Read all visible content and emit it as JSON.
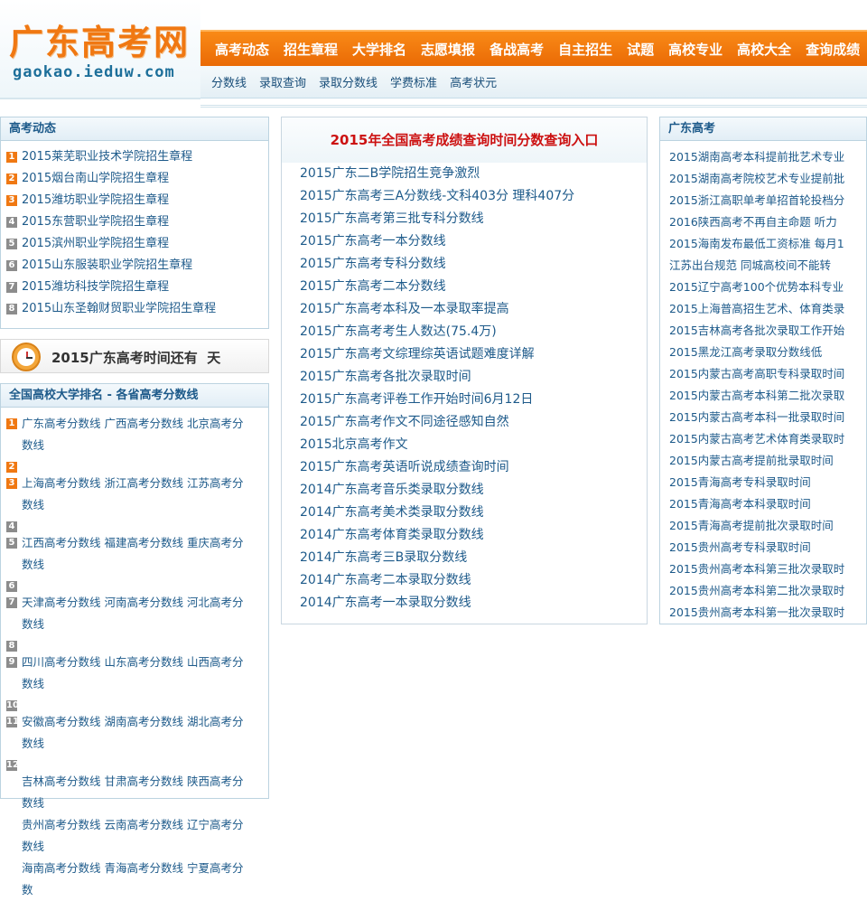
{
  "logo": {
    "main": "广东高考网",
    "sub": "gaokao.ieduw.com"
  },
  "nav_main": [
    "高考动态",
    "招生章程",
    "大学排名",
    "志愿填报",
    "备战高考",
    "自主招生",
    "试题",
    "高校专业",
    "高校大全",
    "查询成绩"
  ],
  "nav_sub": [
    "分数线",
    "录取查询",
    "录取分数线",
    "学费标准",
    "高考状元"
  ],
  "left_news": {
    "title": "高考动态",
    "items": [
      {
        "num": "1",
        "text": "2015莱芜职业技术学院招生章程"
      },
      {
        "num": "2",
        "text": "2015烟台南山学院招生章程"
      },
      {
        "num": "3",
        "text": "2015潍坊职业学院招生章程"
      },
      {
        "num": "4",
        "text": "2015东营职业学院招生章程"
      },
      {
        "num": "5",
        "text": "2015滨州职业学院招生章程"
      },
      {
        "num": "6",
        "text": "2015山东服装职业学院招生章程"
      },
      {
        "num": "7",
        "text": "2015潍坊科技学院招生章程"
      },
      {
        "num": "8",
        "text": "2015山东圣翰财贸职业学院招生章程"
      }
    ]
  },
  "countdown": {
    "text": "2015广东高考时间还有  天"
  },
  "left_rank": {
    "title": "全国高校大学排名 - 各省高考分数线",
    "items": [
      {
        "num": "1",
        "text": "广东高考分数线  广西高考分数线  北京高考分数线"
      },
      {
        "num": "2",
        "text": ""
      },
      {
        "num": "3",
        "text": "上海高考分数线  浙江高考分数线  江苏高考分数线"
      },
      {
        "num": "4",
        "text": ""
      },
      {
        "num": "5",
        "text": "江西高考分数线  福建高考分数线  重庆高考分数线"
      },
      {
        "num": "6",
        "text": ""
      },
      {
        "num": "7",
        "text": "天津高考分数线  河南高考分数线  河北高考分数线"
      },
      {
        "num": "8",
        "text": ""
      },
      {
        "num": "9",
        "text": "四川高考分数线  山东高考分数线  山西高考分数线"
      },
      {
        "num": "10",
        "text": ""
      },
      {
        "num": "11",
        "text": "安徽高考分数线  湖南高考分数线  湖北高考分数线"
      },
      {
        "num": "12",
        "text": ""
      },
      {
        "num": "",
        "text": "吉林高考分数线  甘肃高考分数线  陕西高考分数线"
      },
      {
        "num": "",
        "text": "贵州高考分数线  云南高考分数线  辽宁高考分数线"
      },
      {
        "num": "",
        "text": "海南高考分数线  青海高考分数线  宁夏高考分数"
      }
    ]
  },
  "center": {
    "title": "2015年全国高考成绩查询时间分数查询入口",
    "items": [
      "2015广东二B学院招生竞争激烈",
      "2015广东高考三A分数线-文科403分 理科407分",
      "2015广东高考第三批专科分数线",
      "2015广东高考一本分数线",
      "2015广东高考专科分数线",
      "2015广东高考二本分数线",
      "2015广东高考本科及一本录取率提高",
      "2015广东高考考生人数达(75.4万)",
      "2015广东高考文综理综英语试题难度详解",
      "2015广东高考各批次录取时间",
      "2015广东高考评卷工作开始时间6月12日",
      "2015广东高考作文不同途径感知自然",
      "2015北京高考作文",
      "2015广东高考英语听说成绩查询时间",
      "2014广东高考音乐类录取分数线",
      "2014广东高考美术类录取分数线",
      "2014广东高考体育类录取分数线",
      "2014广东高考三B录取分数线",
      "2014广东高考二本录取分数线",
      "2014广东高考一本录取分数线"
    ]
  },
  "right": {
    "title": "广东高考",
    "items": [
      "2015湖南高考本科提前批艺术专业",
      "2015湖南高考院校艺术专业提前批",
      "2015浙江高职单考单招首轮投档分",
      "2016陕西高考不再自主命题 听力",
      "2015海南发布最低工资标准 每月1",
      "江苏出台规范 同城高校间不能转",
      "2015辽宁高考100个优势本科专业",
      "2015上海普高招生艺术、体育类录",
      "2015吉林高考各批次录取工作开始",
      "2015黑龙江高考录取分数线低",
      "2015内蒙古高考高职专科录取时间",
      "2015内蒙古高考本科第二批次录取",
      "2015内蒙古高考本科一批录取时间",
      "2015内蒙古高考艺术体育类录取时",
      "2015内蒙古高考提前批录取时间",
      "2015青海高考专科录取时间",
      "2015青海高考本科录取时间",
      "2015青海高考提前批次录取时间",
      "2015贵州高考专科录取时间",
      "2015贵州高考本科第三批次录取时",
      "2015贵州高考本科第二批次录取时",
      "2015贵州高考本科第一批次录取时"
    ]
  },
  "colors": {
    "accent": "#f07812",
    "link": "#1d5a8a",
    "headline": "#cc1111"
  }
}
